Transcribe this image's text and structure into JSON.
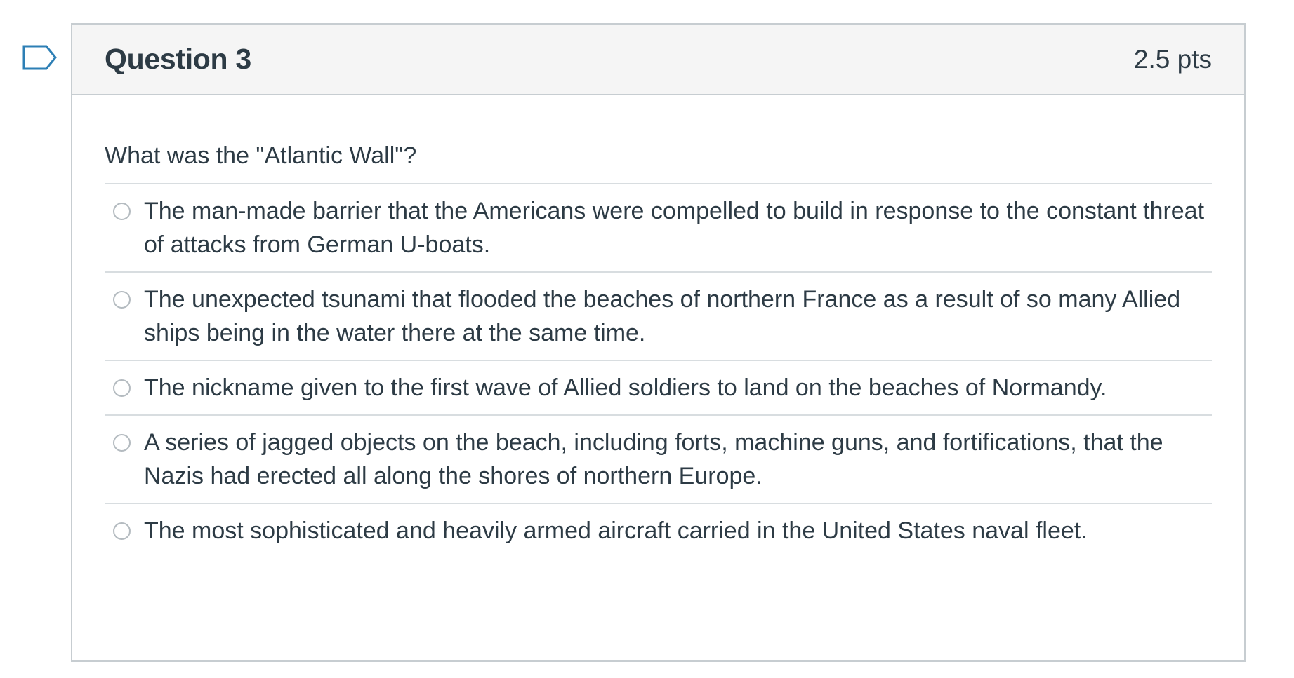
{
  "flag": {
    "icon": "flag-outline-icon",
    "color": "#2d7fb5"
  },
  "question": {
    "title": "Question 3",
    "points": "2.5 pts",
    "text": "What was the \"Atlantic Wall\"?",
    "answers": [
      {
        "label": "The man-made barrier that the Americans were compelled to build in response to the constant threat of attacks from German U-boats.",
        "selected": false
      },
      {
        "label": "The unexpected tsunami that flooded the beaches of northern France as a result of so many Allied ships being in the water there at the same time.",
        "selected": false
      },
      {
        "label": "The nickname given to the first wave of Allied soldiers to land on the beaches of Normandy.",
        "selected": false
      },
      {
        "label": "A series of jagged objects on the beach, including forts, machine guns, and fortifications, that the Nazis had erected all along the shores of northern Europe.",
        "selected": false
      },
      {
        "label": "The most sophisticated and heavily armed aircraft carried in the United States naval fleet.",
        "selected": false
      }
    ]
  },
  "colors": {
    "text": "#2d3b45",
    "header_bg": "#f5f5f5",
    "border": "#c7cdd1"
  }
}
